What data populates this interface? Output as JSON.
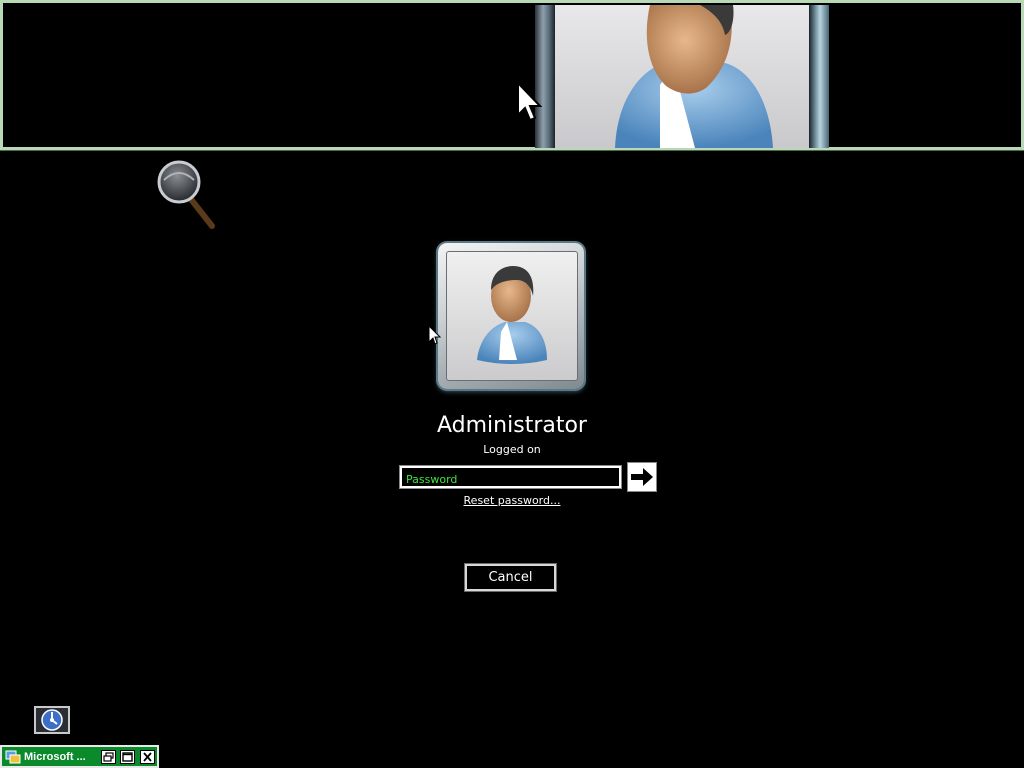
{
  "login": {
    "username": "Administrator",
    "status": "Logged on",
    "password_placeholder": "Password",
    "reset_link": "Reset password...",
    "cancel_label": "Cancel"
  },
  "taskbar": {
    "item_label": "Microsoft ..."
  },
  "icons": {
    "user_picture": "user-avatar-icon",
    "submit": "arrow-right-icon",
    "ease_of_access": "ease-of-access-icon",
    "magnifier": "magnifier-icon",
    "cursor": "mouse-pointer-icon"
  },
  "colors": {
    "background": "#000000",
    "password_text": "#3fe23f",
    "taskbar": "#0a8a2a",
    "magnifier_border": "#b8d8b8"
  }
}
